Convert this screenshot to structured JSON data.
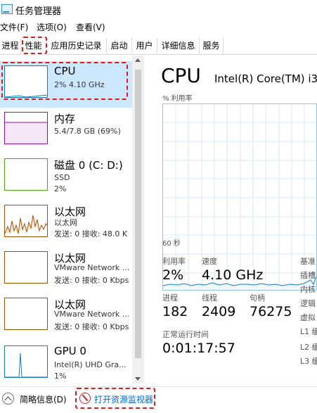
{
  "window": {
    "title": "任务管理器"
  },
  "menu": [
    "文件(F)",
    "选项(O)",
    "查看(V)"
  ],
  "tabs": [
    "进程",
    "性能",
    "应用历史记录",
    "启动",
    "用户",
    "详细信息",
    "服务"
  ],
  "active_tab": "性能",
  "resources": [
    {
      "title": "CPU",
      "lines": [
        "2%  4.10 GHz"
      ],
      "color": "#117dbb"
    },
    {
      "title": "内存",
      "lines": [
        "5.4/7.8 GB (69%)"
      ],
      "color": "#8b12ae"
    },
    {
      "title": "磁盘 0 (C: D:)",
      "lines": [
        "SSD",
        "2%"
      ],
      "color": "#4da60c"
    },
    {
      "title": "以太网",
      "lines": [
        "以太网",
        "发送: 0  接收: 48.0 K"
      ],
      "color": "#a74f01"
    },
    {
      "title": "以太网",
      "lines": [
        "VMware Network ...",
        "发送: 0  接收: 0 Kbps"
      ],
      "color": "#a74f01"
    },
    {
      "title": "以太网",
      "lines": [
        "VMware Network ...",
        "发送: 0  接收: 0 Kbps"
      ],
      "color": "#a74f01"
    },
    {
      "title": "GPU 0",
      "lines": [
        "Intel(R) UHD Gra...",
        "1%"
      ],
      "color": "#117dbb"
    }
  ],
  "detail": {
    "title": "CPU",
    "model": "Intel(R) Core(TM) i3",
    "util_label": "% 利用率",
    "time_label": "60 秒",
    "stats": {
      "utilization_label": "利用率",
      "utilization": "2%",
      "speed_label": "速度",
      "speed": "4.10 GHz",
      "processes_label": "进程",
      "processes": "182",
      "threads_label": "线程",
      "threads": "2409",
      "handles_label": "句柄",
      "handles": "76275",
      "uptime_label": "正常运行时间",
      "uptime": "0:01:17:57"
    },
    "side_labels": [
      "基准",
      "插槽",
      "内核",
      "逻辑",
      "虚拟",
      "L1 缓",
      "L2 缓",
      "L3 缓"
    ]
  },
  "footer": {
    "brief_label": "简略信息(D)",
    "monitor_label": "打开资源监视器"
  }
}
